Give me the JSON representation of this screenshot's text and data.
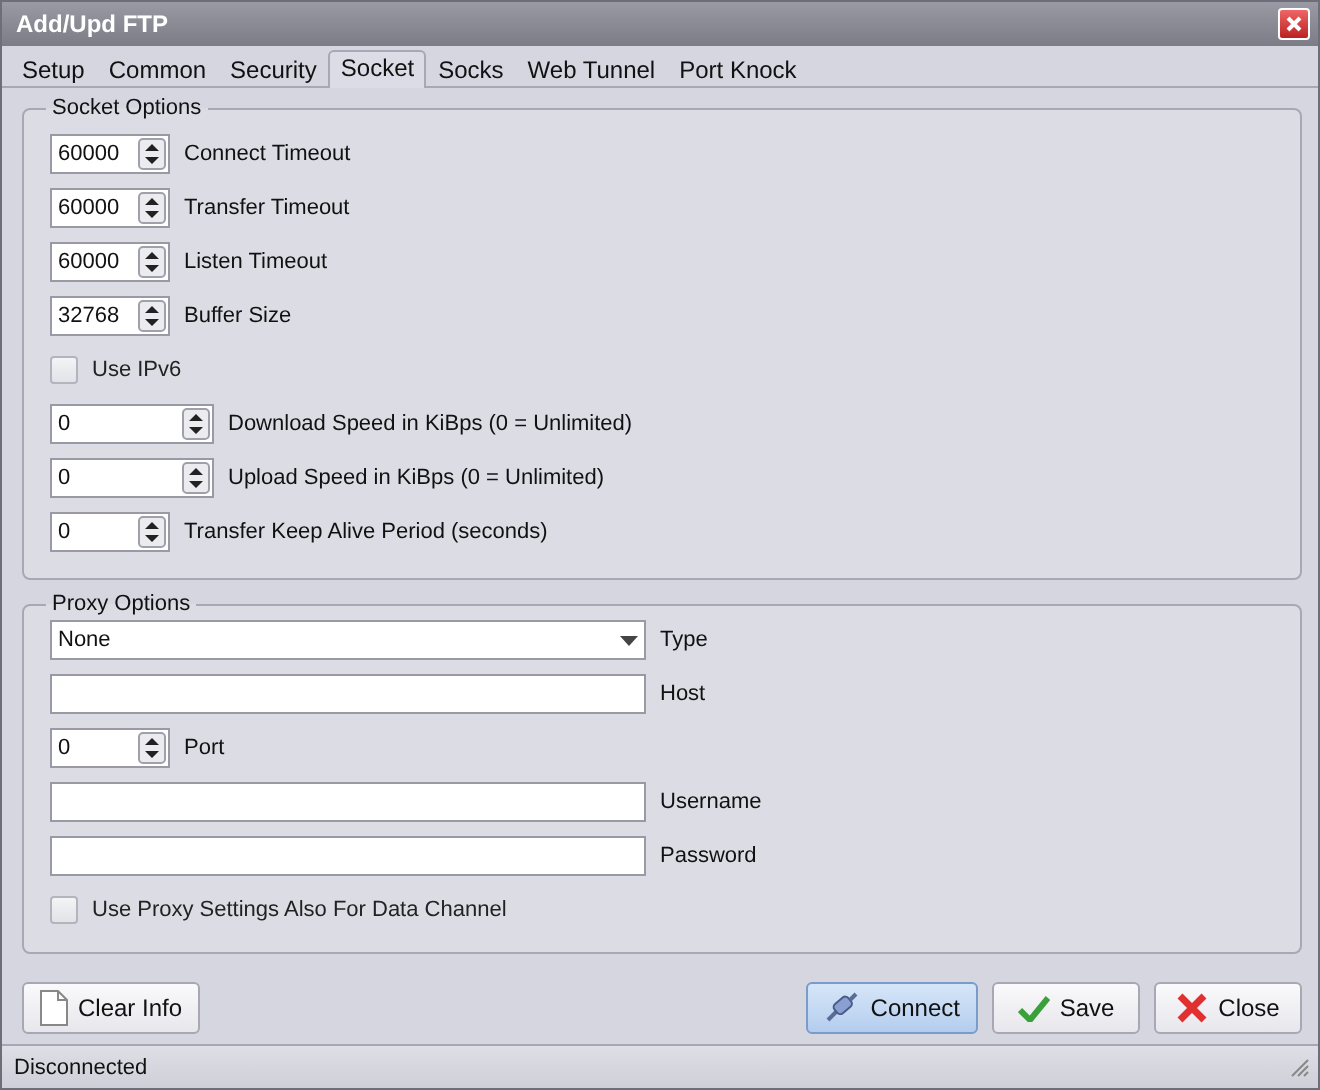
{
  "window": {
    "title": "Add/Upd FTP"
  },
  "tabs": [
    {
      "label": "Setup",
      "selected": false
    },
    {
      "label": "Common",
      "selected": false
    },
    {
      "label": "Security",
      "selected": false
    },
    {
      "label": "Socket",
      "selected": true
    },
    {
      "label": "Socks",
      "selected": false
    },
    {
      "label": "Web Tunnel",
      "selected": false
    },
    {
      "label": "Port Knock",
      "selected": false
    }
  ],
  "socket_options": {
    "title": "Socket Options",
    "rows": [
      {
        "kind": "spin-short",
        "value": "60000",
        "label": "Connect Timeout"
      },
      {
        "kind": "spin-short",
        "value": "60000",
        "label": "Transfer Timeout"
      },
      {
        "kind": "spin-short",
        "value": "60000",
        "label": "Listen Timeout"
      },
      {
        "kind": "spin-short",
        "value": "32768",
        "label": "Buffer Size"
      },
      {
        "kind": "checkbox",
        "label": "Use IPv6",
        "checked": false
      },
      {
        "kind": "spin-long",
        "value": "0",
        "label": "Download Speed in KiBps (0 = Unlimited)"
      },
      {
        "kind": "spin-long",
        "value": "0",
        "label": "Upload Speed in KiBps (0 = Unlimited)"
      },
      {
        "kind": "spin-short",
        "value": "0",
        "label": "Transfer Keep Alive Period (seconds)"
      }
    ]
  },
  "proxy_options": {
    "title": "Proxy Options",
    "rows": [
      {
        "kind": "dropdown",
        "value": "None",
        "label": "Type"
      },
      {
        "kind": "text",
        "label": "Host"
      },
      {
        "kind": "spin-short",
        "value": "0",
        "label": "Port"
      },
      {
        "kind": "text",
        "label": "Username"
      },
      {
        "kind": "text",
        "label": "Password"
      },
      {
        "kind": "checkbox",
        "label": "Use Proxy Settings Also For Data Channel",
        "checked": false
      }
    ]
  },
  "buttons": [
    {
      "kind": "clear",
      "label": "Clear Info"
    },
    {
      "kind": "connect",
      "label": "Connect"
    },
    {
      "kind": "save",
      "label": "Save"
    },
    {
      "kind": "close",
      "label": "Close"
    }
  ],
  "status_bar": {
    "text": "Disconnected"
  }
}
